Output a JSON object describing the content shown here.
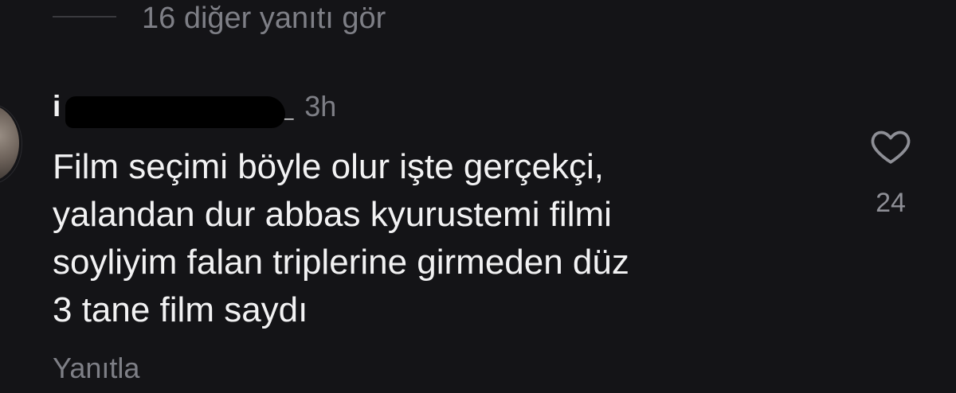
{
  "thread": {
    "more_replies_label": "16 diğer yanıtı gör"
  },
  "comment": {
    "username_prefix": "i",
    "username_suffix": "_",
    "timestamp": "3h",
    "text": "Film seçimi böyle olur işte gerçekçi,\nyalandan dur abbas kyurustemi filmi\nsoyliyim falan triplerine girmeden düz\n3 tane film saydı",
    "reply_label": "Yanıtla",
    "like_count": "24",
    "like_icon": "heart-icon"
  },
  "colors": {
    "background": "#141417",
    "primary_text": "#f2f2f3",
    "secondary_text": "#7e7f86"
  }
}
